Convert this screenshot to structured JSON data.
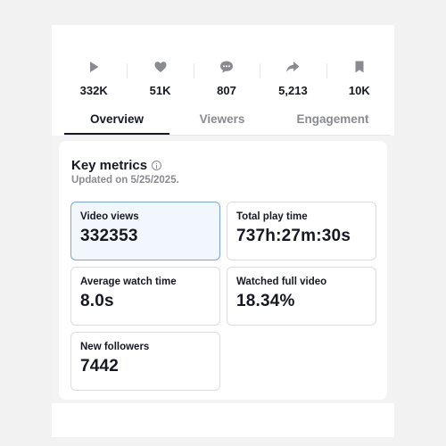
{
  "stats": [
    {
      "icon": "play-icon",
      "value": "332K"
    },
    {
      "icon": "heart-icon",
      "value": "51K"
    },
    {
      "icon": "comment-icon",
      "value": "807"
    },
    {
      "icon": "share-icon",
      "value": "5,213"
    },
    {
      "icon": "bookmark-icon",
      "value": "10K"
    }
  ],
  "tabs": [
    {
      "label": "Overview",
      "active": true
    },
    {
      "label": "Viewers",
      "active": false
    },
    {
      "label": "Engagement",
      "active": false
    }
  ],
  "key_metrics": {
    "title": "Key metrics",
    "updated": "Updated on 5/25/2025."
  },
  "metrics": [
    {
      "label": "Video views",
      "value": "332353",
      "selected": true
    },
    {
      "label": "Total play time",
      "value": "737h:27m:30s",
      "selected": false
    },
    {
      "label": "Average watch time",
      "value": "8.0s",
      "selected": false
    },
    {
      "label": "Watched full video",
      "value": "18.34%",
      "selected": false
    },
    {
      "label": "New followers",
      "value": "7442",
      "selected": false
    }
  ],
  "colors": {
    "icon_gray": "#8a8b91",
    "text_dark": "#161823",
    "selected_bg": "#f2f7fd",
    "selected_border": "#7aa6dc"
  }
}
